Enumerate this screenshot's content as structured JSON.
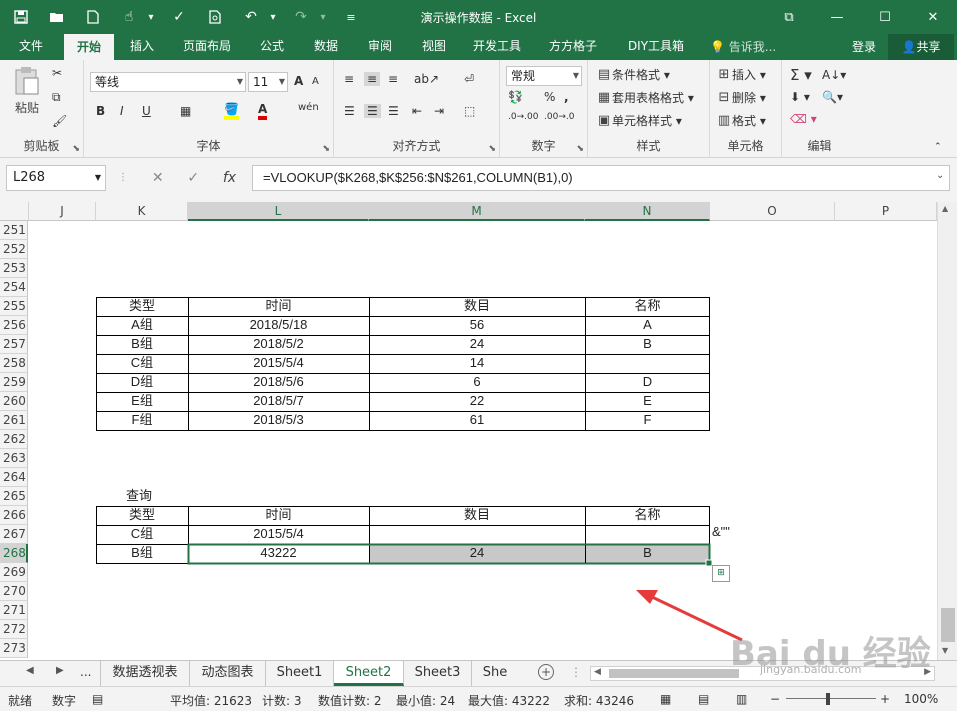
{
  "window": {
    "title": "演示操作数据 - Excel",
    "quick_access": [
      "save-icon",
      "open-icon",
      "new-icon",
      "touch-icon",
      "spellcheck-icon",
      "preview-icon",
      "undo-icon",
      "redo-icon"
    ]
  },
  "menu": {
    "tabs": [
      "文件",
      "开始",
      "插入",
      "页面布局",
      "公式",
      "数据",
      "审阅",
      "视图",
      "开发工具",
      "方方格子",
      "DIY工具箱"
    ],
    "active": "开始",
    "tell_me": "告诉我...",
    "login": "登录",
    "share": "共享"
  },
  "ribbon": {
    "clipboard": {
      "label": "剪贴板",
      "paste": "粘贴"
    },
    "font": {
      "label": "字体",
      "name": "等线",
      "size": "11",
      "bold": "B",
      "italic": "I",
      "underline": "U",
      "grow": "A",
      "shrink": "A"
    },
    "alignment": {
      "label": "对齐方式"
    },
    "number": {
      "label": "数字",
      "format": "常规",
      "percent": "%"
    },
    "styles": {
      "label": "样式",
      "conditional": "条件格式",
      "table": "套用表格格式",
      "cell": "单元格样式"
    },
    "cells": {
      "label": "单元格",
      "insert": "插入",
      "delete": "删除",
      "format": "格式"
    },
    "editing": {
      "label": "编辑"
    }
  },
  "formula_bar": {
    "name_box": "L268",
    "fx": "fx",
    "formula": "=VLOOKUP($K268,$K$256:$N$261,COLUMN(B1),0)"
  },
  "sheet": {
    "columns": [
      "J",
      "K",
      "L",
      "M",
      "N",
      "O",
      "P"
    ],
    "rows": [
      "251",
      "252",
      "253",
      "254",
      "255",
      "256",
      "257",
      "258",
      "259",
      "260",
      "261",
      "262",
      "263",
      "264",
      "265",
      "266",
      "267",
      "268",
      "269",
      "270",
      "271",
      "272",
      "273"
    ],
    "selected_row": "268",
    "table1": {
      "headers": [
        "类型",
        "时间",
        "数目",
        "名称"
      ],
      "rows": [
        [
          "A组",
          "2018/5/18",
          "56",
          "A"
        ],
        [
          "B组",
          "2018/5/2",
          "24",
          "B"
        ],
        [
          "C组",
          "2015/5/4",
          "14",
          ""
        ],
        [
          "D组",
          "2018/5/6",
          "6",
          "D"
        ],
        [
          "E组",
          "2018/5/7",
          "22",
          "E"
        ],
        [
          "F组",
          "2018/5/3",
          "61",
          "F"
        ]
      ]
    },
    "query_label": "查询",
    "table2": {
      "headers": [
        "类型",
        "时间",
        "数目",
        "名称"
      ],
      "rows": [
        [
          "C组",
          "2015/5/4",
          "",
          ""
        ],
        [
          "B组",
          "43222",
          "24",
          "B"
        ]
      ]
    },
    "note": "&\"\""
  },
  "sheet_tabs": {
    "tabs": [
      "数据透视表",
      "动态图表",
      "Sheet1",
      "Sheet2",
      "Sheet3",
      "She"
    ],
    "active": "Sheet2",
    "more": "..."
  },
  "status_bar": {
    "ready": "就绪",
    "mode": "数字",
    "average": "平均值: 21623",
    "count": "计数: 3",
    "numeric_count": "数值计数: 2",
    "min": "最小值: 24",
    "max": "最大值: 43222",
    "sum": "求和: 43246",
    "zoom": "100%"
  },
  "watermark": {
    "brand": "Bai du 经验",
    "url": "jingyan.baidu.com"
  },
  "colors": {
    "accent": "#217346",
    "selection_fill": "#c8c8c8",
    "arrow": "#e53b3b"
  }
}
